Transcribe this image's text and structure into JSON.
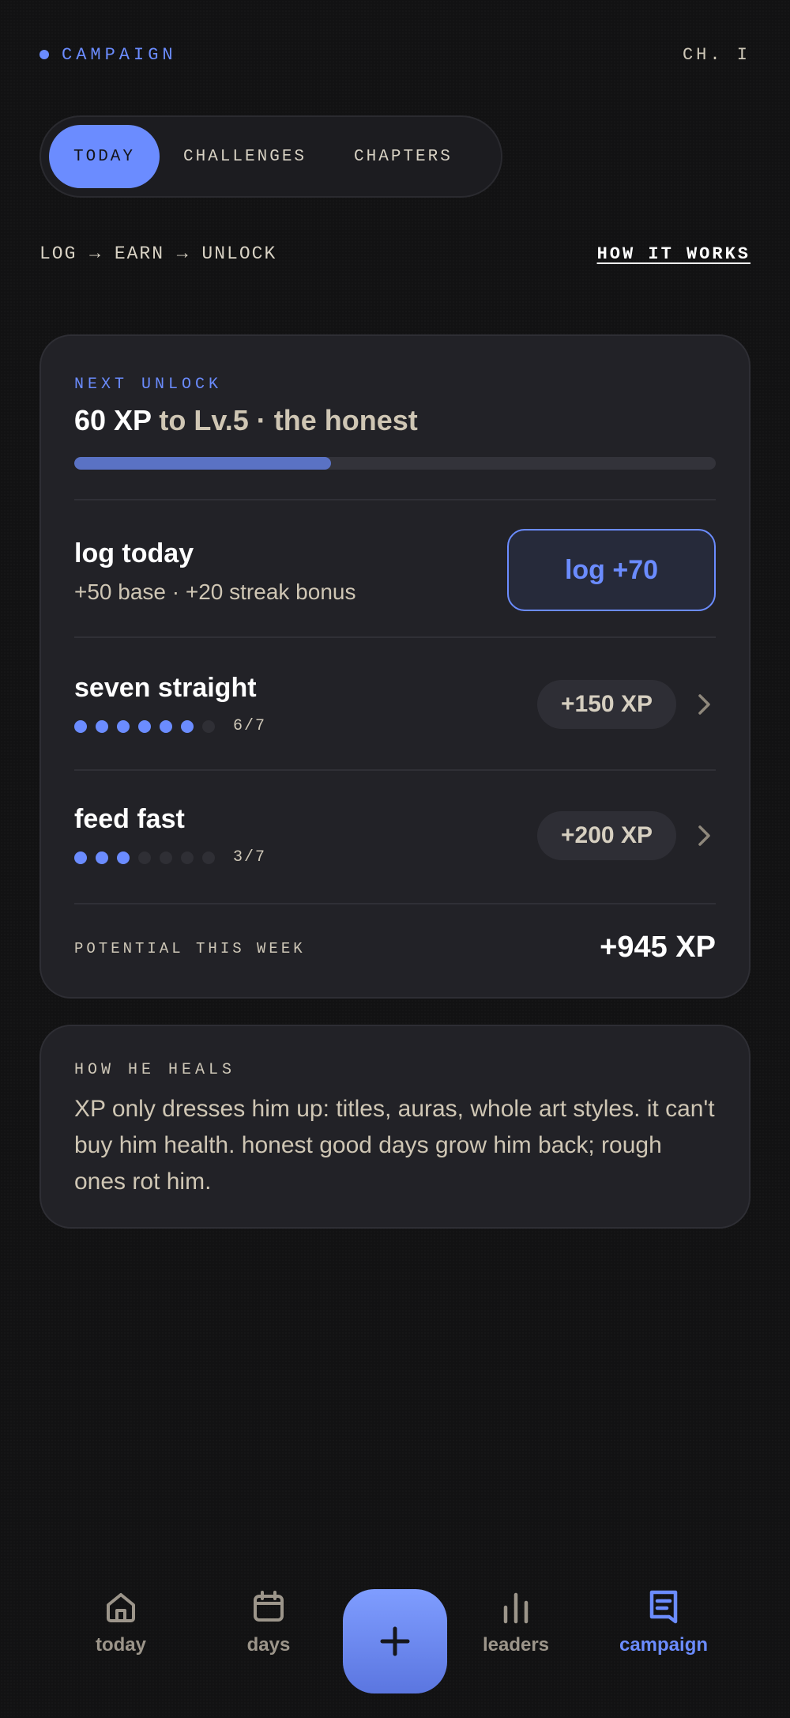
{
  "header": {
    "brand_label": "CAMPAIGN",
    "chapter": "CH. I"
  },
  "tabs": [
    {
      "label": "TODAY",
      "active": true
    },
    {
      "label": "CHALLENGES",
      "active": false
    },
    {
      "label": "CHAPTERS",
      "active": false
    }
  ],
  "flow": {
    "text": "LOG → EARN → UNLOCK",
    "link": "HOW IT WORKS"
  },
  "next_unlock": {
    "eyebrow": "NEXT UNLOCK",
    "xp": "60 XP",
    "rest": " to Lv.5 · the honest",
    "progress": 0.4
  },
  "log_today": {
    "title": "log today",
    "subtitle": "+50 base · +20 streak bonus",
    "button": "log +70"
  },
  "challenges": [
    {
      "title": "seven straight",
      "progress": "6/7",
      "filled": 6,
      "total": 7,
      "reward": "+150 XP"
    },
    {
      "title": "feed fast",
      "progress": "3/7",
      "filled": 3,
      "total": 7,
      "reward": "+200 XP"
    }
  ],
  "potential": {
    "label": "POTENTIAL THIS WEEK",
    "value": "+945 XP"
  },
  "heals": {
    "eyebrow": "HOW HE HEALS",
    "text": "XP only dresses him up: titles, auras, whole art styles. it can't buy him health. honest good days grow him back; rough ones rot him."
  },
  "nav": {
    "items": [
      {
        "label": "today",
        "icon": "home-icon",
        "active": false
      },
      {
        "label": "days",
        "icon": "calendar-icon",
        "active": false
      },
      {
        "label": "leaders",
        "icon": "bars-icon",
        "active": false
      },
      {
        "label": "campaign",
        "icon": "flag-book-icon",
        "active": true
      }
    ],
    "fab_icon": "plus-icon"
  },
  "colors": {
    "accent": "#6b8cff",
    "background": "#121213",
    "card": "#222227"
  }
}
